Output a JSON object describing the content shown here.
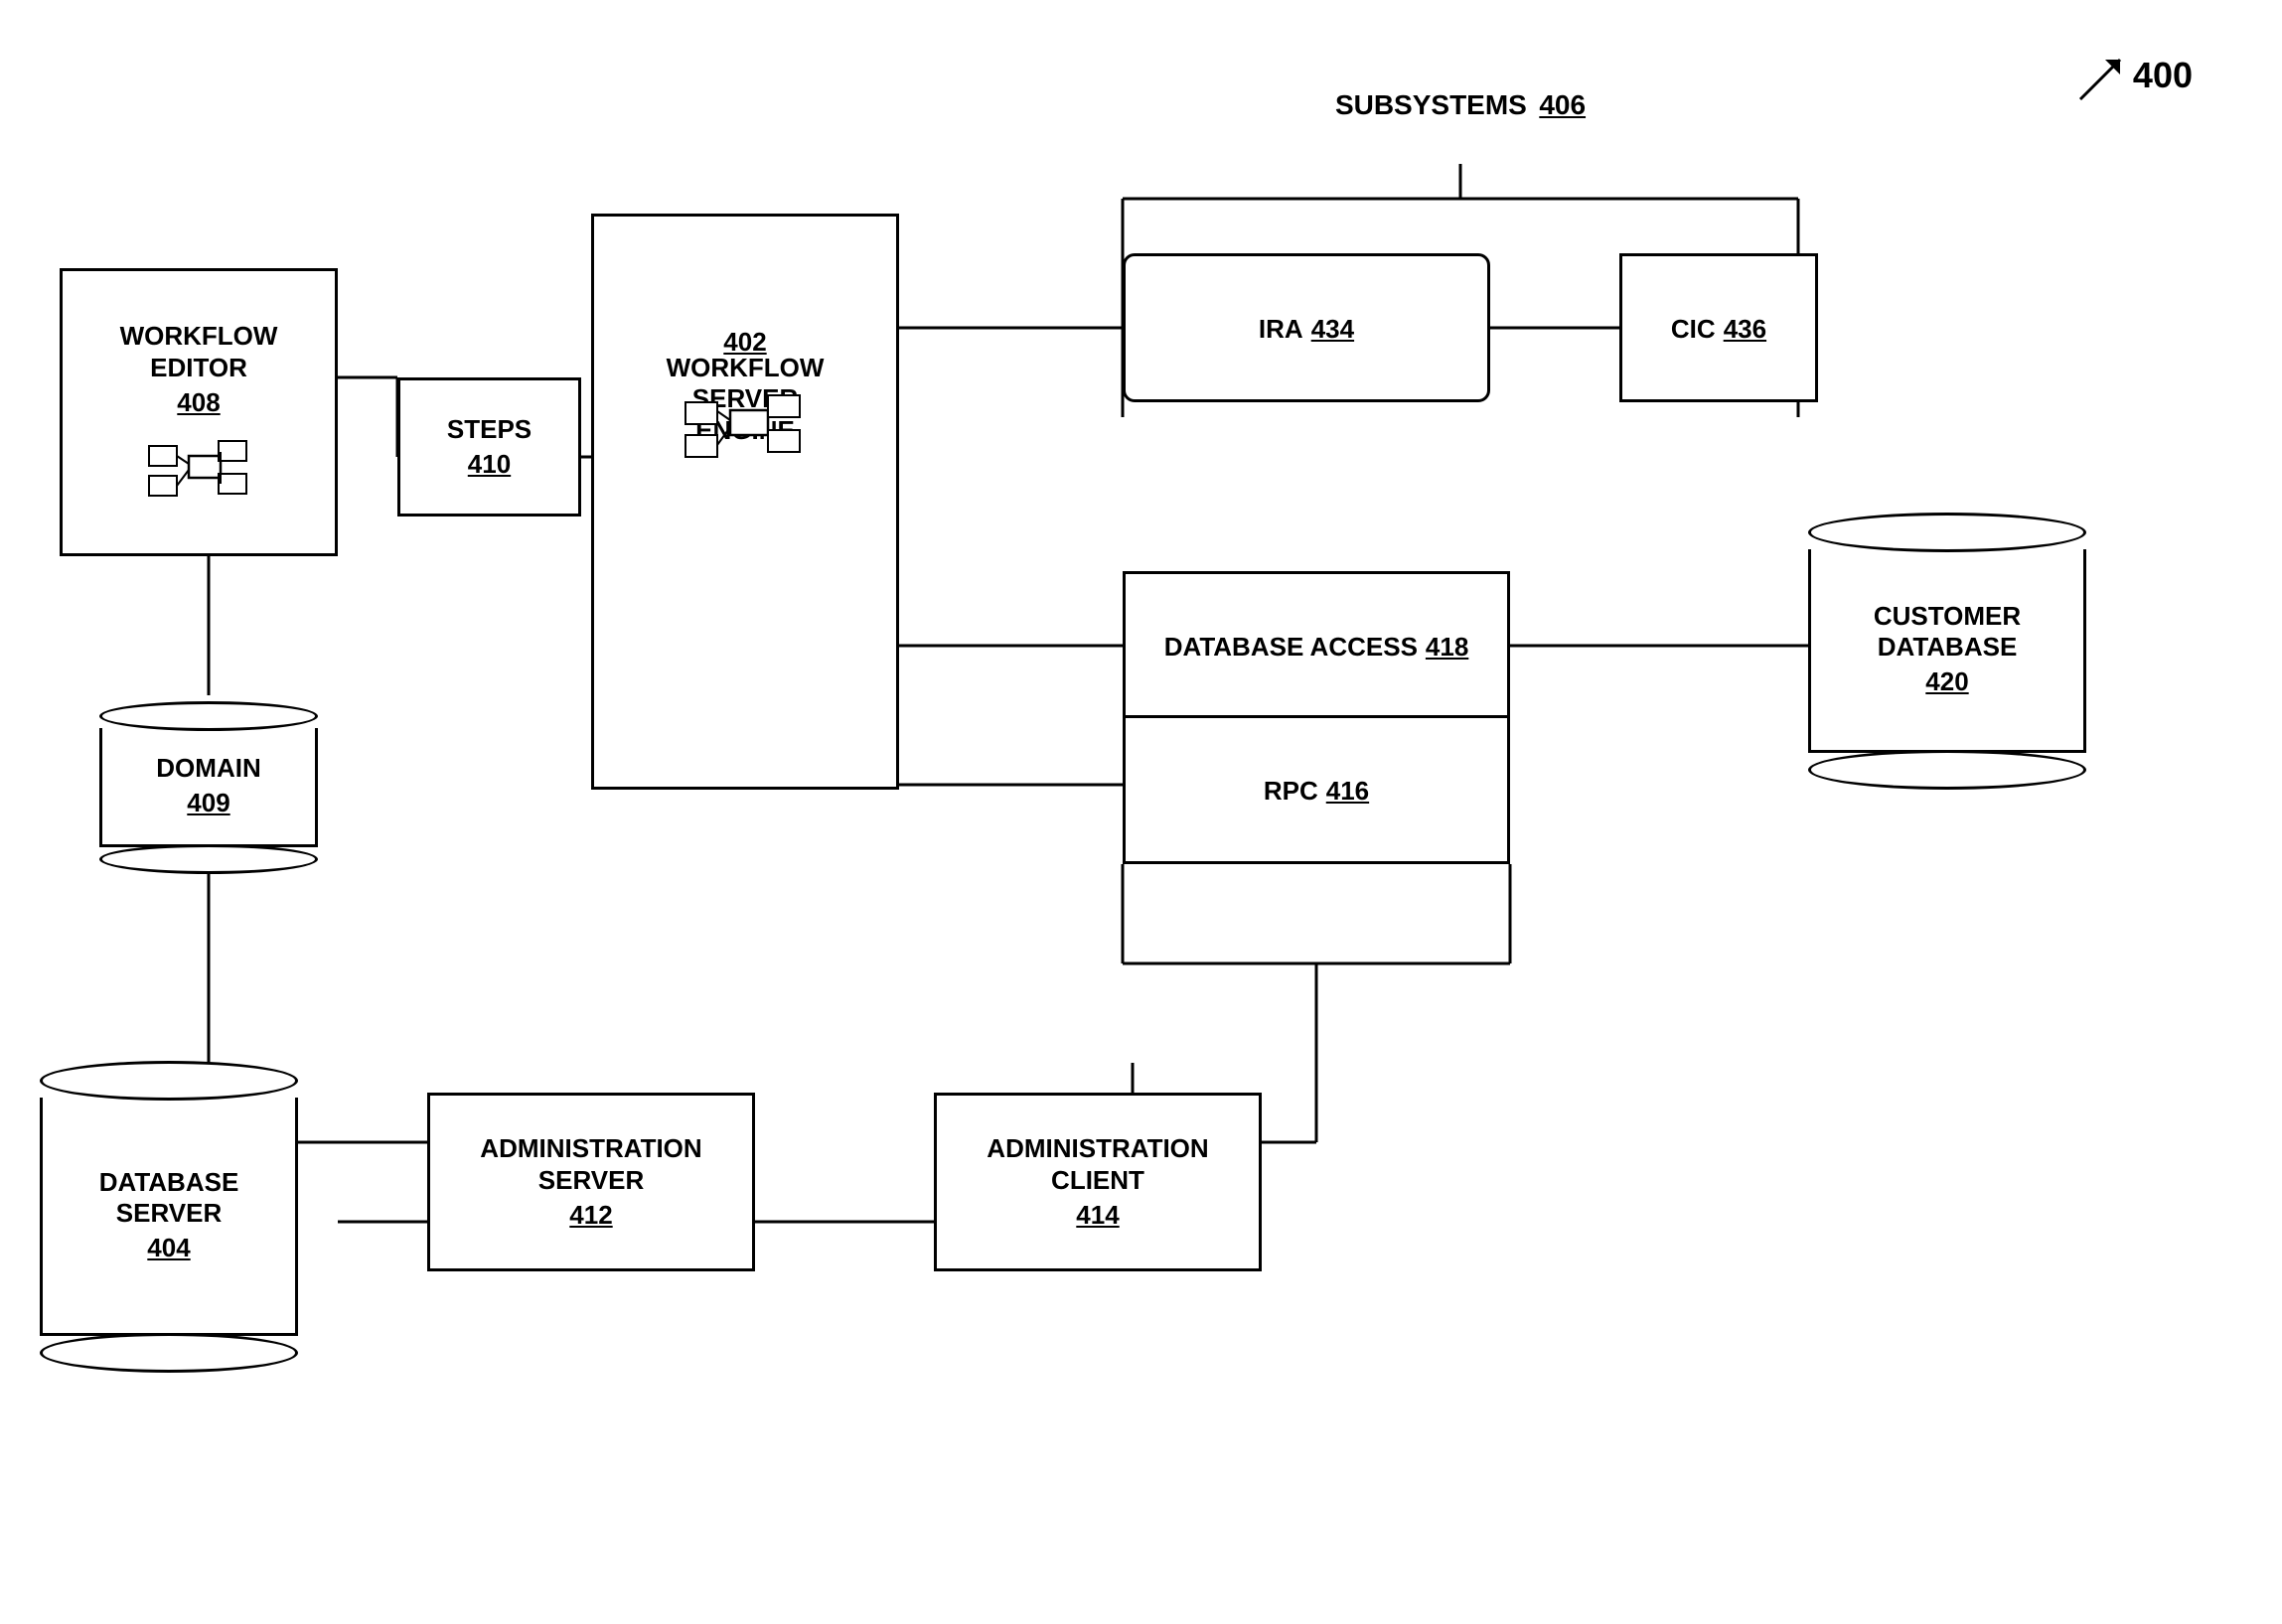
{
  "figure": {
    "number": "400",
    "arrow": "↗"
  },
  "nodes": {
    "workflow_editor": {
      "label": "WORKFLOW\nEDITOR",
      "number": "408"
    },
    "domain": {
      "label": "DOMAIN",
      "number": "409"
    },
    "steps": {
      "label": "STEPS",
      "number": "410"
    },
    "workflow_server_engine": {
      "label": "WORKFLOW\nSERVER\nENGINE",
      "number": "402"
    },
    "ira": {
      "label": "IRA",
      "number": "434"
    },
    "cic": {
      "label": "CIC",
      "number": "436"
    },
    "database_access": {
      "label": "DATABASE ACCESS",
      "number": "418"
    },
    "rpc": {
      "label": "RPC",
      "number": "416"
    },
    "customer_database": {
      "label": "CUSTOMER\nDATABASE",
      "number": "420"
    },
    "database_server": {
      "label": "DATABASE\nSERVER",
      "number": "404"
    },
    "administration_server": {
      "label": "ADMINISTRATION\nSERVER",
      "number": "412"
    },
    "administration_client": {
      "label": "ADMINISTRATION\nCLIENT",
      "number": "414"
    },
    "subsystems": {
      "label": "SUBSYSTEMS",
      "number": "406"
    }
  }
}
